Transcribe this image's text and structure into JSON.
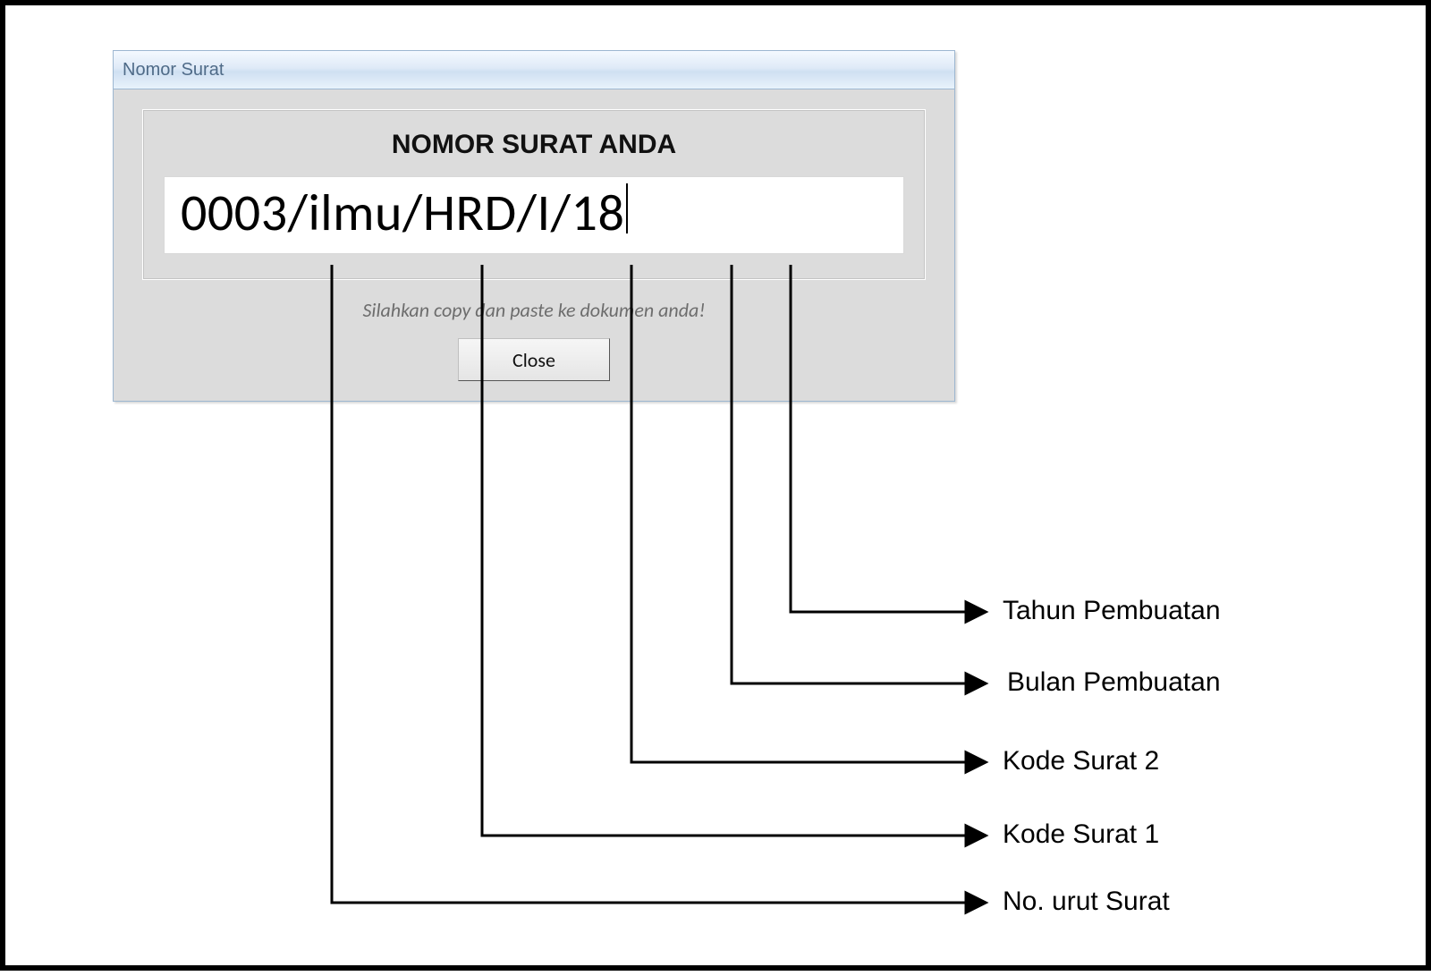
{
  "dialog": {
    "title": "Nomor Surat",
    "heading": "NOMOR SURAT ANDA",
    "reference_number": "0003/ilmu/HRD/I/18",
    "hint_text": "Silahkan copy dan paste ke dokumen anda!",
    "close_label": "Close"
  },
  "annotations": {
    "tahun": "Tahun Pembuatan",
    "bulan": "Bulan Pembuatan",
    "kode2": "Kode Surat 2",
    "kode1": "Kode Surat 1",
    "nourut": "No. urut Surat"
  },
  "reference_parts": {
    "no_urut": "0003",
    "kode_surat_1": "ilmu",
    "kode_surat_2": "HRD",
    "bulan": "I",
    "tahun": "18"
  }
}
